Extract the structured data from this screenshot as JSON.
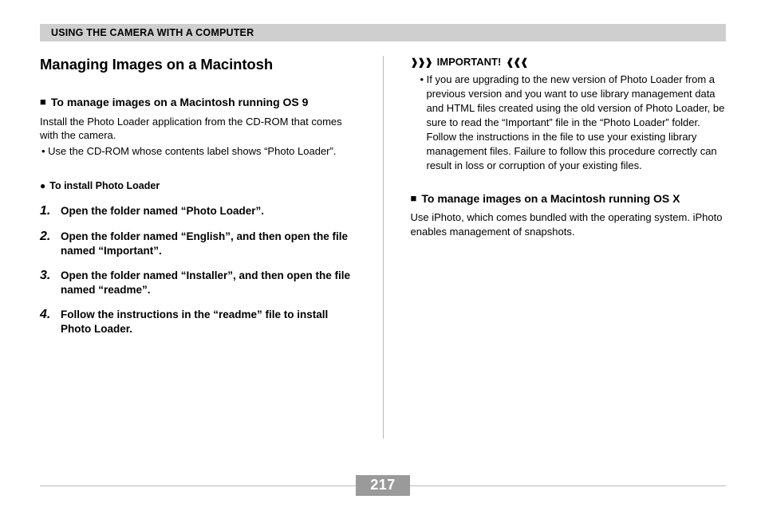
{
  "header": "USING THE CAMERA WITH A COMPUTER",
  "left": {
    "title": "Managing Images on a Macintosh",
    "sub1": "To manage images on a Macintosh running OS 9",
    "intro": "Install the Photo Loader application from the CD-ROM that comes with the camera.",
    "bullet": "• Use the CD-ROM whose contents label shows “Photo Loader”.",
    "installHeading": "To install Photo Loader",
    "steps": [
      "Open the folder named “Photo Loader”.",
      "Open the folder named “English”, and then open the file named “Important”.",
      "Open the folder named “Installer”, and then open the file named “readme”.",
      "Follow the instructions in the “readme” file to install Photo Loader."
    ]
  },
  "right": {
    "importantLabel": "IMPORTANT!",
    "importantText": "• If you are upgrading to the new version of Photo Loader from a previous version and you want to use library management data and HTML files created using the old version of Photo Loader, be sure to read the “Important” file in the “Photo Loader” folder. Follow the instructions in the file to use your existing library management files. Failure to follow this procedure correctly can result in loss or corruption of your existing files.",
    "sub2": "To manage images on a Macintosh running OS X",
    "osxText": "Use iPhoto, which comes bundled with the operating system. iPhoto enables management of snapshots."
  },
  "pageNumber": "217"
}
